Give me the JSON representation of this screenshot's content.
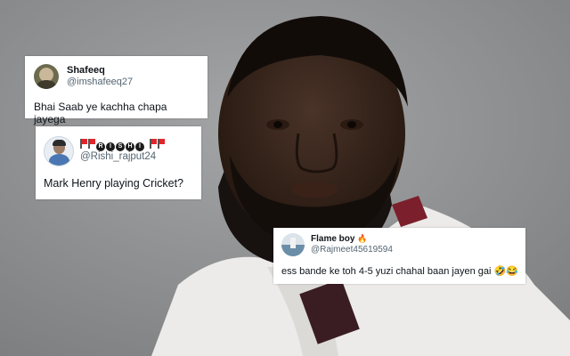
{
  "tweets": [
    {
      "name": "Shafeeq",
      "handle": "@imshafeeq27",
      "text": "Bhai Saab ye kachha chapa jayega"
    },
    {
      "name_letters": [
        "R",
        "I",
        "S",
        "H",
        "I"
      ],
      "name": "🚩🚩RISHI🚩🚩",
      "handle": "@Rishi_rajput24",
      "text": "Mark Henry playing Cricket?"
    },
    {
      "name": "Flame boy",
      "name_emoji": "🔥",
      "handle": "@Rajmeet45619594",
      "text": "ess bande ke toh 4-5 yuzi chahal baan  jayen gai 🤣😂"
    }
  ],
  "colors": {
    "background": "#8e8f91",
    "card": "#ffffff",
    "name": "#0f1419",
    "handle": "#536471",
    "flag": "#e0262a"
  }
}
